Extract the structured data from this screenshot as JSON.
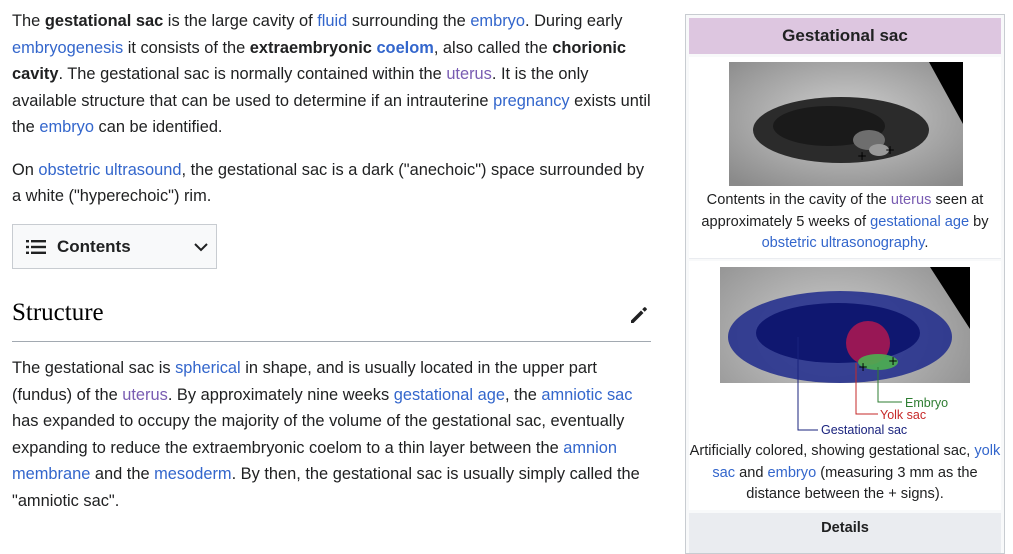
{
  "article": {
    "intro": {
      "t1": "The ",
      "b1": "gestational sac",
      "t2": " is the large cavity of ",
      "l_fluid": "fluid",
      "t3": " surrounding the ",
      "l_embryo": "embryo",
      "t4": ". During early ",
      "l_embryogenesis": "embryogenesis",
      "t5": " it consists of the ",
      "b2": "extraembryonic ",
      "l_coelom": "coelom",
      "t6": ", also called the ",
      "b3": "chorionic cavity",
      "t7": ". The gestational sac is normally contained within the ",
      "l_uterus": "uterus",
      "t8": ". It is the only available structure that can be used to determine if an intrauterine ",
      "l_pregnancy": "pregnancy",
      "t9": " exists until the ",
      "l_embryo2": "embryo",
      "t10": " can be identified."
    },
    "ultrasound": {
      "t1": "On ",
      "l_obstetric": "obstetric ultrasound",
      "t2": ", the gestational sac is a dark (\"anechoic\") space surrounded by a white (\"hyperechoic\") rim."
    },
    "toc": {
      "label": "Contents",
      "icon": "list-icon"
    },
    "structure": {
      "heading": "Structure",
      "t1": "The gestational sac is ",
      "l_spherical": "spherical",
      "t2": " in shape, and is usually located in the upper part (fundus) of the ",
      "l_uterus": "uterus",
      "t3": ". By approximately nine weeks ",
      "l_gest_age": "gestational age",
      "t4": ", the ",
      "l_amniotic": "amniotic sac",
      "t5": " has expanded to occupy the majority of the volume of the gestational sac, eventually expanding to reduce the extraembryonic coelom to a thin layer between the ",
      "l_amnion": "amnion membrane",
      "t6": " and the ",
      "l_mesoderm": "mesoderm",
      "t7": ". By then, the gestational sac is usually simply called the \"amniotic sac\"."
    }
  },
  "infobox": {
    "title": "Gestational sac",
    "image1_caption": {
      "t1": "Contents in the cavity of the ",
      "l_uterus": "uterus",
      "t2": " seen at approximately 5 weeks of ",
      "l_gest_age": "gestational age",
      "t3": " by ",
      "l_ultrasonography": "obstetric ultrasonography",
      "t4": "."
    },
    "image2_labels": {
      "embryo": "Embryo",
      "yolk": "Yolk sac",
      "sac": "Gestational sac"
    },
    "image2_caption": {
      "t1": "Artificially colored, showing gestational sac, ",
      "l_yolk": "yolk sac",
      "t2": " and ",
      "l_embryo": "embryo",
      "t3": " (measuring 3 mm as the distance between the + signs)."
    },
    "details": "Details"
  },
  "colors": {
    "link": "#3366cc",
    "visited_link": "#795cb2",
    "infobox_header": "#ddc6e0",
    "label_embryo": "#2e7d32",
    "label_yolk": "#c62828",
    "label_sac": "#1a237e"
  }
}
